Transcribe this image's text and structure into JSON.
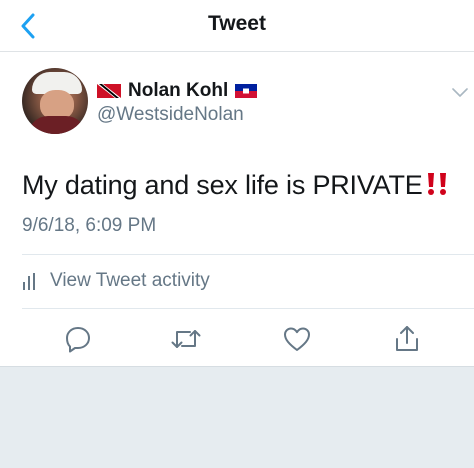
{
  "navbar": {
    "title": "Tweet",
    "back_icon": "chevron-left-icon"
  },
  "tweet": {
    "author": {
      "display_name": "Nolan Kohl",
      "handle": "@WestsideNolan",
      "flags": [
        "trinidad-and-tobago-flag-icon",
        "haiti-flag-icon"
      ]
    },
    "text": "My dating and sex life is PRIVATE",
    "emoji": "double-exclamation-icon",
    "timestamp": "9/6/18, 6:09 PM"
  },
  "activity": {
    "label": "View Tweet activity",
    "icon": "bar-chart-icon"
  },
  "actions": [
    "reply-icon",
    "retweet-icon",
    "like-icon",
    "share-icon"
  ],
  "colors": {
    "accent": "#1da1f2",
    "text_primary": "#14171a",
    "text_secondary": "#657786",
    "icon_grey": "#657786",
    "divider": "#e1e8ed",
    "footer_bg": "#e6ecf0",
    "emoji_red": "#d0021b"
  }
}
